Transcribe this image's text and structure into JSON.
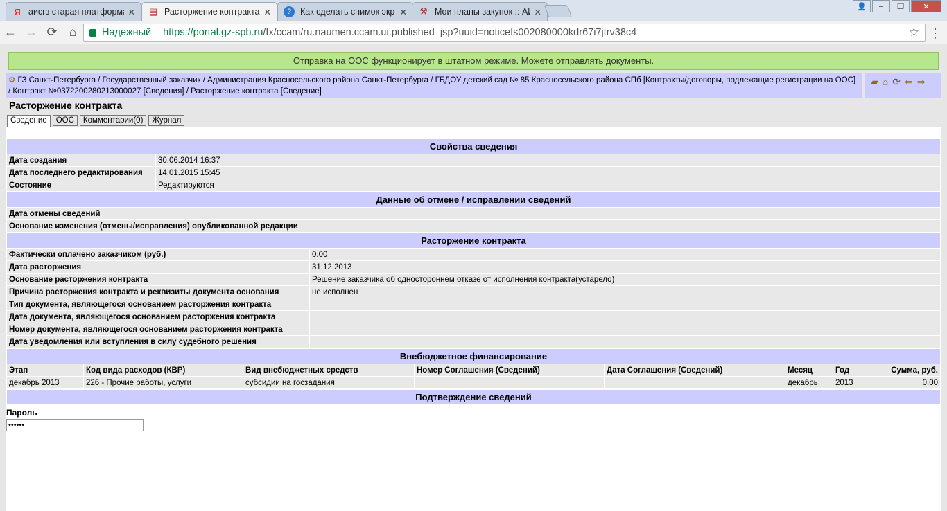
{
  "browser": {
    "tabs": [
      {
        "title": "аисгз старая платформа",
        "icon": "yandex-icon",
        "active": false
      },
      {
        "title": "Расторжение контракта",
        "icon": "document-icon",
        "active": true
      },
      {
        "title": "Как сделать снимок экр",
        "icon": "help-icon",
        "active": false
      },
      {
        "title": "Мои планы закупок :: АИ",
        "icon": "tools-icon",
        "active": false
      }
    ],
    "secure_label": "Надежный",
    "url_host": "https://portal.gz-spb.ru",
    "url_path": "/fx/ccam/ru.naumen.ccam.ui.published_jsp?uuid=noticefs002080000kdr67i7jtrv38c4"
  },
  "banner": "Отправка на ООС функционирует в штатном режиме. Можете отправлять документы.",
  "breadcrumb": "ГЗ Санкт-Петербурга / Государственный заказчик / Администрация Красносельского района Санкт-Петербурга / ГБДОУ детский сад № 85 Красносельского района СПб [Контракты/договоры, подлежащие регистрации на ООС] / Контракт №0372200280213000027 [Сведения] / Расторжение контракта [Сведение]",
  "page_title": "Расторжение контракта",
  "tabs": [
    "Сведение",
    "ООС",
    "Комментарии(0)",
    "Журнал"
  ],
  "sections": {
    "props": {
      "title": "Свойства сведения",
      "rows": [
        [
          "Дата создания",
          "30.06.2014 16:37"
        ],
        [
          "Дата последнего редактирования",
          "14.01.2015 15:45"
        ],
        [
          "Состояние",
          "Редактируются"
        ]
      ]
    },
    "cancel": {
      "title": "Данные об отмене / исправлении сведений",
      "rows": [
        [
          "Дата отмены сведений",
          ""
        ],
        [
          "Основание изменения (отмены/исправления) опубликованной редакции",
          ""
        ]
      ]
    },
    "termination": {
      "title": "Расторжение контракта",
      "rows": [
        [
          "Фактически оплачено заказчиком (руб.)",
          "0.00"
        ],
        [
          "Дата расторжения",
          "31.12.2013"
        ],
        [
          "Основание расторжения контракта",
          "Решение заказчика об одностороннем отказе от исполнения контракта(устарело)"
        ],
        [
          "Причина расторжения контракта и реквизиты документа основания",
          "не исполнен"
        ],
        [
          "Тип документа, являющегося основанием расторжения контракта",
          ""
        ],
        [
          "Дата документа, являющегося основанием расторжения контракта",
          ""
        ],
        [
          "Номер документа, являющегося основанием расторжения контракта",
          ""
        ],
        [
          "Дата уведомления или вступления в силу судебного решения",
          ""
        ]
      ]
    },
    "finance": {
      "title": "Внебюджетное финансирование",
      "headers": [
        "Этап",
        "Код вида расходов (КВР)",
        "Вид внебюджетных средств",
        "Номер Соглашения (Сведений)",
        "Дата Соглашения (Сведений)",
        "Месяц",
        "Год",
        "Сумма, руб."
      ],
      "rows": [
        [
          "декабрь 2013",
          "226 - Прочие работы, услуги",
          "субсидии на госзадания",
          "",
          "",
          "декабрь",
          "2013",
          "0.00"
        ]
      ]
    },
    "confirm": {
      "title": "Подтверждение сведений",
      "password_label": "Пароль",
      "password_value": "••••••"
    }
  }
}
